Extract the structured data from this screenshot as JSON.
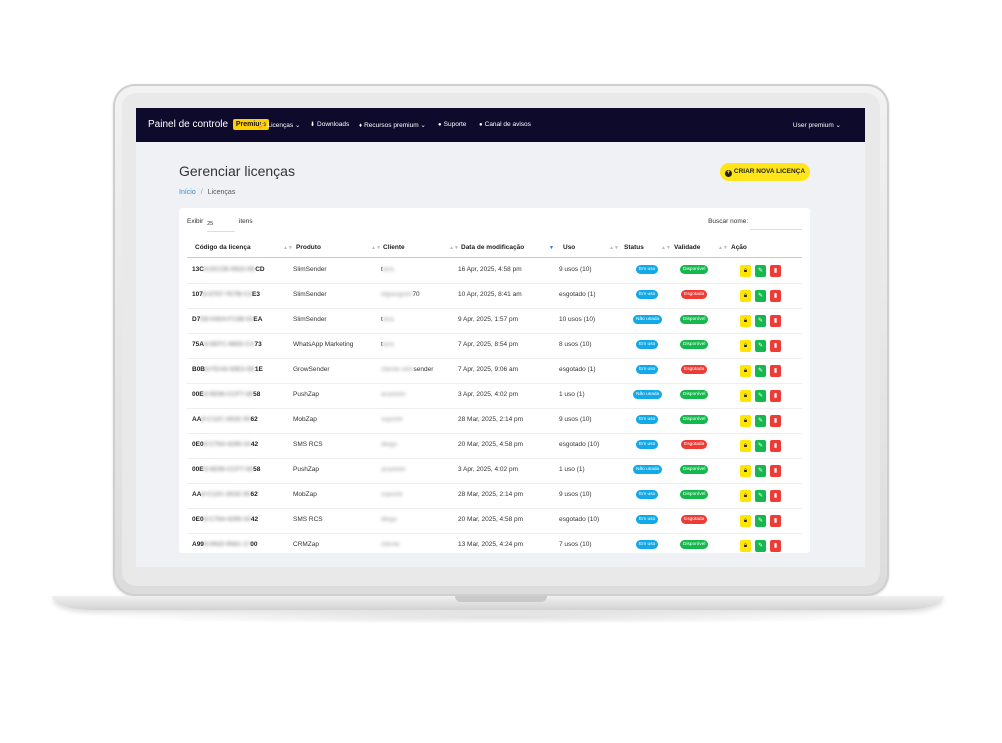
{
  "navbar": {
    "brand": "Painel de controle",
    "brand_badge": "Premium",
    "items": [
      {
        "label": "Licenças",
        "icon": "key-icon",
        "caret": true
      },
      {
        "label": "Downloads",
        "icon": "download-icon",
        "caret": false
      },
      {
        "label": "Recursos premium",
        "icon": "diamond-icon",
        "caret": true
      },
      {
        "label": "Suporte",
        "icon": "chat-icon",
        "caret": false
      },
      {
        "label": "Canal de avisos",
        "icon": "info-icon",
        "caret": false
      }
    ],
    "user": "User premium"
  },
  "page": {
    "title": "Gerenciar licenças",
    "create_button": "CRIAR NOVA LICENÇA",
    "breadcrumb": {
      "home": "Início",
      "current": "Licenças"
    }
  },
  "table_controls": {
    "show_prefix": "Exibir",
    "show_value": "25",
    "show_suffix": "itens",
    "search_label": "Buscar nome:"
  },
  "columns": [
    "Código da licença",
    "Produto",
    "Cliente",
    "Data de modificação",
    "Uso",
    "Status",
    "Validade",
    "Ação"
  ],
  "rows": [
    {
      "code_start": "13C",
      "code_mid": "8-DCCB-0922-0E",
      "code_end": "CD",
      "product": "SlimSender",
      "client_start": "t",
      "client_mid": "ana",
      "client_end": "",
      "date": "16 Apr, 2025, 4:58 pm",
      "usage": "9 usos (10)",
      "status": "Em uso",
      "validity": "Disponível"
    },
    {
      "code_start": "107",
      "code_mid": "8-6757-7E7B-C3",
      "code_end": "E3",
      "product": "SlimSender",
      "client_start": "",
      "client_mid": "elgiaoguim",
      "client_end": "70",
      "date": "10 Apr, 2025, 8:41 am",
      "usage": "esgotado (1)",
      "status": "Em uso",
      "validity": "Esgotada"
    },
    {
      "code_start": "D7",
      "code_mid": "E8-04D4-F13B-03",
      "code_end": "EA",
      "product": "SlimSender",
      "client_start": "t",
      "client_mid": "ana",
      "client_end": "",
      "date": "9 Apr, 2025, 1:57 pm",
      "usage": "10 usos (10)",
      "status": "Não usada",
      "validity": "Disponível"
    },
    {
      "code_start": "75A",
      "code_mid": "8-0EFC-9855-CA",
      "code_end": "73",
      "product": "WhatsApp Marketing",
      "client_start": "t",
      "client_mid": "ana",
      "client_end": "",
      "date": "7 Apr, 2025, 8:54 pm",
      "usage": "8 usos (10)",
      "status": "Em uso",
      "validity": "Disponível"
    },
    {
      "code_start": "B0B",
      "code_mid": "8-FEA6-50E3-5E",
      "code_end": "1E",
      "product": "GrowSender",
      "client_start": "",
      "client_mid": "cliente-slim",
      "client_end": "sender",
      "date": "7 Apr, 2025, 9:06 am",
      "usage": "esgotado (1)",
      "status": "Em uso",
      "validity": "Esgotada"
    },
    {
      "code_start": "00E",
      "code_mid": "8-5E08-CCF7-56",
      "code_end": "58",
      "product": "PushZap",
      "client_start": "",
      "client_mid": "anastolo",
      "client_end": "",
      "date": "3 Apr, 2025, 4:02 pm",
      "usage": "1 uso (1)",
      "status": "Não usada",
      "validity": "Disponível"
    },
    {
      "code_start": "AA",
      "code_mid": "8-C12C-261E-55",
      "code_end": "62",
      "product": "MobZap",
      "client_start": "",
      "client_mid": "suporte",
      "client_end": "",
      "date": "28 Mar, 2025, 2:14 pm",
      "usage": "9 usos (10)",
      "status": "Em uso",
      "validity": "Disponível"
    },
    {
      "code_start": "0E0",
      "code_mid": "8-C764-4295-34",
      "code_end": "42",
      "product": "SMS RCS",
      "client_start": "",
      "client_mid": "diego",
      "client_end": "",
      "date": "20 Mar, 2025, 4:58 pm",
      "usage": "esgotado (10)",
      "status": "Em uso",
      "validity": "Esgotada"
    },
    {
      "code_start": "00E",
      "code_mid": "8-5E08-CCF7-56",
      "code_end": "58",
      "product": "PushZap",
      "client_start": "",
      "client_mid": "anastolo",
      "client_end": "",
      "date": "3 Apr, 2025, 4:02 pm",
      "usage": "1 uso (1)",
      "status": "Não usada",
      "validity": "Disponível"
    },
    {
      "code_start": "AA",
      "code_mid": "8-C12C-261E-55",
      "code_end": "62",
      "product": "MobZap",
      "client_start": "",
      "client_mid": "suporte",
      "client_end": "",
      "date": "28 Mar, 2025, 2:14 pm",
      "usage": "9 usos (10)",
      "status": "Em uso",
      "validity": "Disponível"
    },
    {
      "code_start": "0E0",
      "code_mid": "8-C764-4295-34",
      "code_end": "42",
      "product": "SMS RCS",
      "client_start": "",
      "client_mid": "diego",
      "client_end": "",
      "date": "20 Mar, 2025, 4:58 pm",
      "usage": "esgotado (10)",
      "status": "Em uso",
      "validity": "Esgotada"
    },
    {
      "code_start": "A99",
      "code_mid": "8-0922-9561-17",
      "code_end": "00",
      "product": "CRMZap",
      "client_start": "",
      "client_mid": "cliente",
      "client_end": "",
      "date": "13 Mar, 2025, 4:24 pm",
      "usage": "7 usos (10)",
      "status": "Em uso",
      "validity": "Disponível"
    }
  ],
  "colors": {
    "navbar": "#0d0a2c",
    "accent_yellow": "#ffe51a",
    "status_blue": "#12a9e8",
    "valid_green": "#14b84d",
    "expired_red": "#ef3b35"
  }
}
